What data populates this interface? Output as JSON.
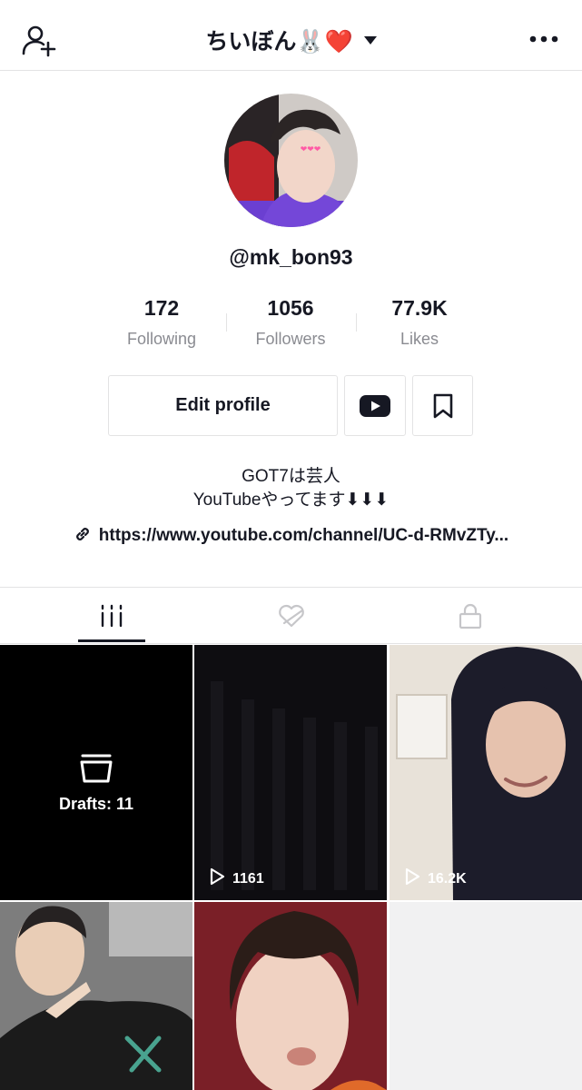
{
  "header": {
    "title": "ちいぼん🐰❤️",
    "add_friend_icon": "person-add-icon",
    "more_icon": "more-horizontal-icon",
    "dropdown_icon": "caret-down-icon"
  },
  "profile": {
    "username": "@mk_bon93",
    "stats": [
      {
        "value": "172",
        "label": "Following"
      },
      {
        "value": "1056",
        "label": "Followers"
      },
      {
        "value": "77.9K",
        "label": "Likes"
      }
    ],
    "edit_profile_label": "Edit profile",
    "youtube_icon": "youtube-icon",
    "bookmark_icon": "bookmark-icon",
    "bio_line1": "GOT7は芸人",
    "bio_line2": "YouTubeやってます⬇︎⬇︎⬇︎",
    "link_text": "https://www.youtube.com/channel/UC-d-RMvZTy..."
  },
  "tabs": [
    {
      "name": "videos",
      "icon": "grid-icon",
      "active": true
    },
    {
      "name": "liked",
      "icon": "liked-hidden-icon",
      "active": false
    },
    {
      "name": "private",
      "icon": "lock-icon",
      "active": false
    }
  ],
  "grid": {
    "drafts_label": "Drafts: 11",
    "videos": [
      {
        "views": "1161"
      },
      {
        "views": "16.2K"
      }
    ]
  },
  "colors": {
    "text": "#161823",
    "muted": "#8a8b91",
    "divider": "#e3e3e4",
    "drafts_bg": "#000000",
    "avatar_shirt": "#6b3fd1"
  }
}
